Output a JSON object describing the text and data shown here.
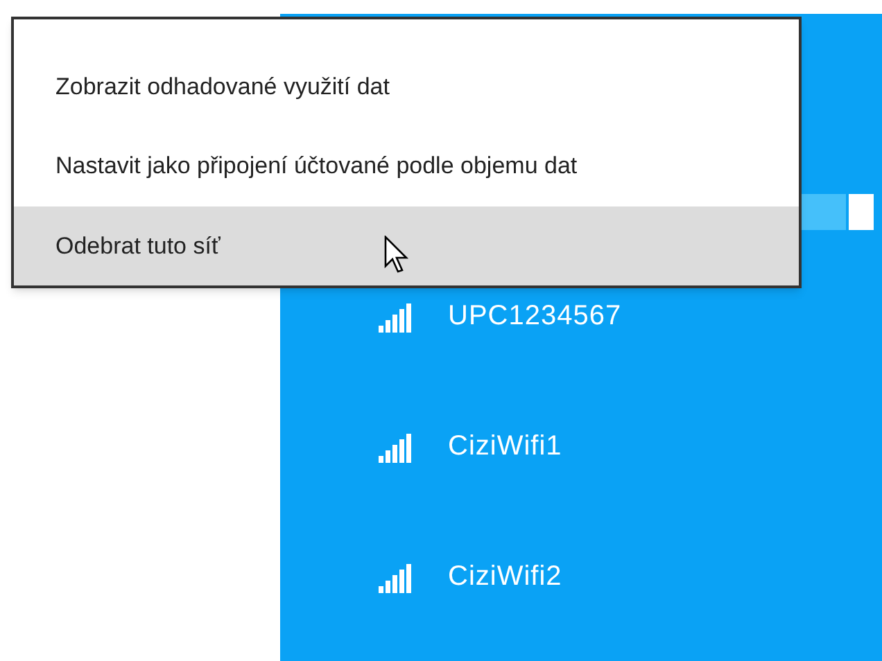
{
  "context_menu": {
    "items": [
      {
        "label": "Zobrazit odhadované využití dat",
        "selected": false
      },
      {
        "label": "Nastavit jako připojení účtované podle objemu dat",
        "selected": false
      },
      {
        "label": "Odebrat tuto síť",
        "selected": true
      }
    ]
  },
  "networks": [
    {
      "name": "UPC1234567"
    },
    {
      "name": "CiziWifi1"
    },
    {
      "name": "CiziWifi2"
    }
  ]
}
